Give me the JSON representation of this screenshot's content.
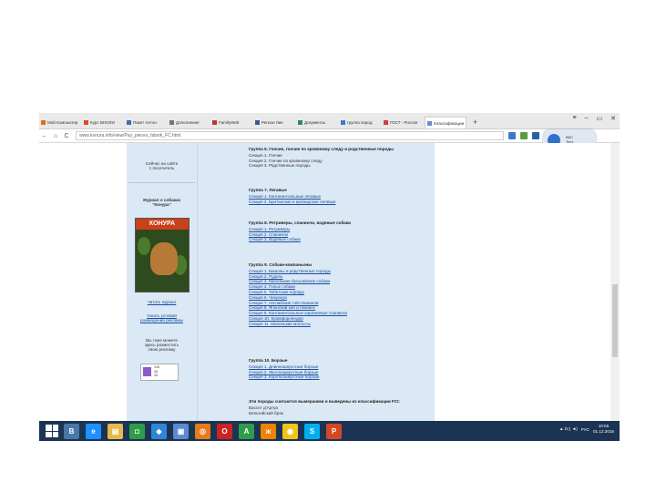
{
  "browser": {
    "tabs": [
      {
        "label": "Мой Компьютер",
        "color": "#e06c1a"
      },
      {
        "label": "Курс ВНОЛИ",
        "color": "#d94b2b"
      },
      {
        "label": "Пакет Антон",
        "color": "#3a6fb0"
      },
      {
        "label": "Дополнения",
        "color": "#777777"
      },
      {
        "label": "FamilyWeb",
        "color": "#c0392b"
      },
      {
        "label": "Регион Лин",
        "color": "#3b5998"
      },
      {
        "label": "Документы",
        "color": "#2e8b57"
      },
      {
        "label": "группа пород",
        "color": "#3f7ad1"
      },
      {
        "label": "ГОСТ - Россия",
        "color": "#d83b3b"
      },
      {
        "label": "Классификации",
        "color": "#6a8fd1"
      }
    ],
    "new_tab": "+",
    "window_controls": [
      "≡",
      "–",
      "▭",
      "✕"
    ],
    "back": "←",
    "home": "⌂",
    "reload": "C",
    "url": "www.konura.info/view/Pay_pieces_fabsik_FC.html",
    "extensions": [
      {
        "name": "extension-1",
        "color": "#3a78c9"
      },
      {
        "name": "extension-2",
        "color": "#5a9c3c"
      },
      {
        "name": "extension-3",
        "color": "#2a5fa8"
      },
      {
        "name": "extension-4",
        "color": "#7a7a7a"
      }
    ],
    "bubble_text": [
      "ВКС",
      "Тест",
      "Мон"
    ]
  },
  "sidebar": {
    "online_label": "Сейчас на сайте",
    "online_count": "1 посетитель",
    "magazine_title_1": "Журнал о собаках",
    "magazine_title_2": "\"Конура\"",
    "magazine_cover_title": "КОНУРА",
    "read_more": "Читать журнал",
    "rules_1": "Узнать условия",
    "rules_2": "размещения рекламы",
    "promo_1": "Вы тоже можете",
    "promo_2": "здесь разместить",
    "promo_3": "свою рекламу",
    "counter_lines": [
      "125",
      "45",
      "16"
    ]
  },
  "groups": [
    {
      "title": "Группа 6. Гончие, гончие по кровяному следу и родственные породы",
      "items": [
        "Секция 1. Гончие",
        "Секция 2. Гончие по кровяному следу",
        "Секция 3. Родственные породы"
      ],
      "plain": true
    },
    {
      "title": "Группа 7. Легавые",
      "items": [
        "Секция 1. Континентальные легавые",
        "Секция 2. Британские и ирландские легавые"
      ],
      "plain": false
    },
    {
      "title": "Группа 8. Ретриверы, спаниели, водяные собаки",
      "items": [
        "Секция 1. Ретриверы",
        "Секция 2. Спаниели",
        "Секция 3. Водяные собаки"
      ],
      "plain": false
    },
    {
      "title": "Группа 9. Собаки-компаньоны",
      "items": [
        "Секция 1. Бишоны и родственные породы",
        "Секция 2. Пудель",
        "Секция 3. Маленькие бельгийские собаки",
        "Секция 4. Голые собаки",
        "Секция 5. Тибетские породы",
        "Секция 6. Чихуахуа",
        "Секция 7. Английские той-спаниели",
        "Секция 8. Японский хин и пекинес",
        "Секция 9. Континентальные карликовые спаниели",
        "Секция 10. Кромфорлендер",
        "Секция 11. Маленькие молоссы"
      ],
      "plain": false
    },
    {
      "title": "Группа 10. Борзые",
      "items": [
        "Секция 1. Длинношерстные борзые",
        "Секция 2. Жесткошерстные борзые",
        "Секция 3. Короткошерстные борзые"
      ],
      "plain": false
    }
  ],
  "excluded": {
    "title": "Эти породы считаются вымершими и выведены из классификации FCI:",
    "items": [
      "Бассет д'Артуа",
      "Бельгийский брак"
    ]
  },
  "taskbar": {
    "apps": [
      {
        "name": "vk-app",
        "glyph": "В",
        "color": "#4a76a8"
      },
      {
        "name": "edge-browser",
        "glyph": "e",
        "color": "#1e90ff"
      },
      {
        "name": "file-explorer",
        "glyph": "▤",
        "color": "#e8b84a"
      },
      {
        "name": "store",
        "glyph": "◘",
        "color": "#2e9c4a"
      },
      {
        "name": "dropbox",
        "glyph": "◆",
        "color": "#2f86d8"
      },
      {
        "name": "photos",
        "glyph": "▣",
        "color": "#5a8ad1"
      },
      {
        "name": "media-player",
        "glyph": "◎",
        "color": "#e87a1a"
      },
      {
        "name": "opera-browser",
        "glyph": "O",
        "color": "#cc2222"
      },
      {
        "name": "yandex-disk",
        "glyph": "A",
        "color": "#2e9c4a"
      },
      {
        "name": "odnoklassniki",
        "glyph": "ж",
        "color": "#ee8208"
      },
      {
        "name": "chrome-browser",
        "glyph": "◉",
        "color": "#f0c419"
      },
      {
        "name": "skype",
        "glyph": "S",
        "color": "#00aff0"
      },
      {
        "name": "powerpoint",
        "glyph": "P",
        "color": "#d24726"
      }
    ],
    "lang": "РУС",
    "time": "10:55",
    "date": "01.12.2016"
  }
}
